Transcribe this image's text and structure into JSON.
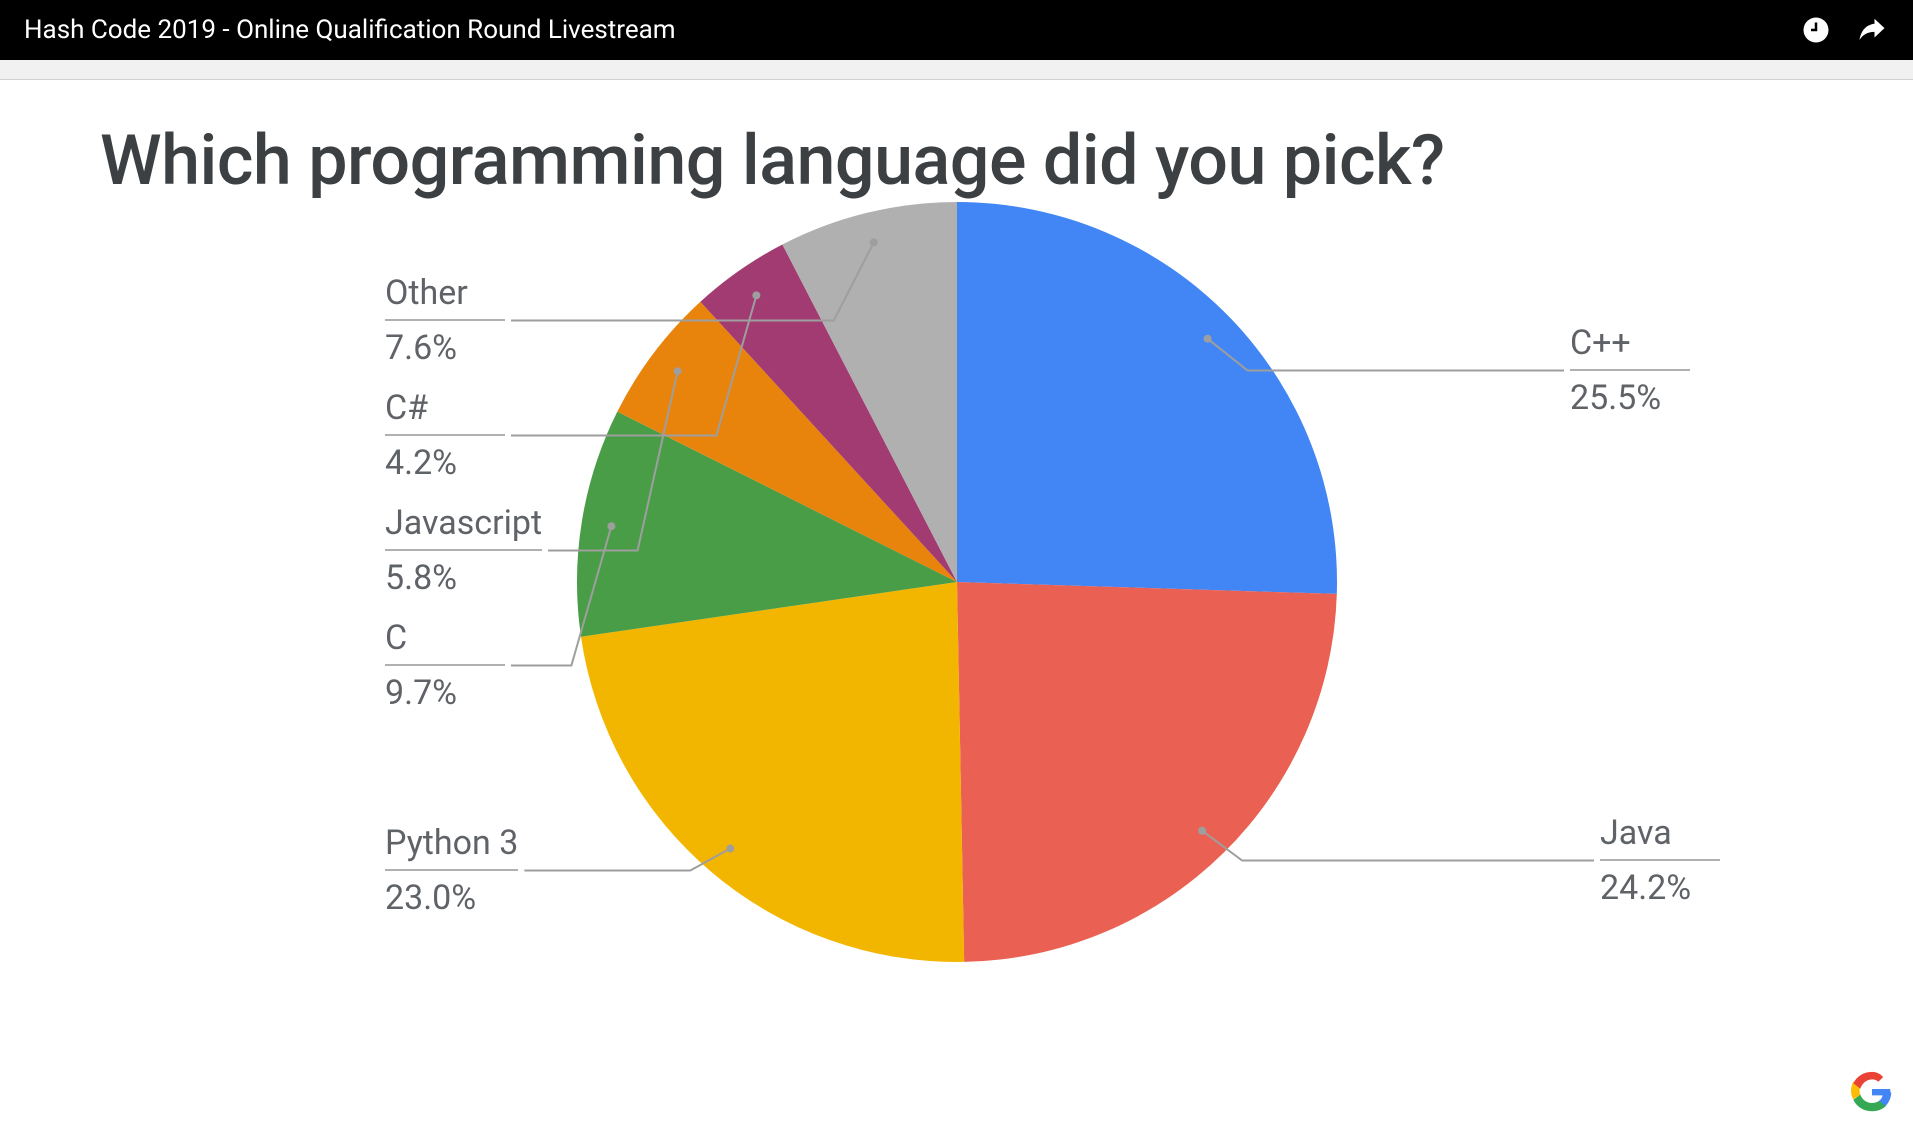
{
  "topbar": {
    "title": "Hash Code 2019 - Online Qualification Round Livestream"
  },
  "chart_data": {
    "type": "pie",
    "title": "Which programming language did you pick?",
    "series": [
      {
        "name": "C++",
        "value": 25.5,
        "color": "#4285f4"
      },
      {
        "name": "Java",
        "value": 24.2,
        "color": "#ea6153"
      },
      {
        "name": "Python 3",
        "value": 23.0,
        "color": "#f3b600"
      },
      {
        "name": "C",
        "value": 9.7,
        "color": "#4a9d47"
      },
      {
        "name": "Javascript",
        "value": 5.8,
        "color": "#e8830c"
      },
      {
        "name": "C#",
        "value": 4.2,
        "color": "#a23b72"
      },
      {
        "name": "Other",
        "value": 7.6,
        "color": "#b0b0b0"
      }
    ]
  },
  "labels": {
    "cpp": {
      "name": "C++",
      "pct": "25.5%"
    },
    "java": {
      "name": "Java",
      "pct": "24.2%"
    },
    "py": {
      "name": "Python 3",
      "pct": "23.0%"
    },
    "c": {
      "name": "C",
      "pct": "9.7%"
    },
    "js": {
      "name": "Javascript",
      "pct": "5.8%"
    },
    "cs": {
      "name": "C#",
      "pct": "4.2%"
    },
    "other": {
      "name": "Other",
      "pct": "7.6%"
    }
  }
}
